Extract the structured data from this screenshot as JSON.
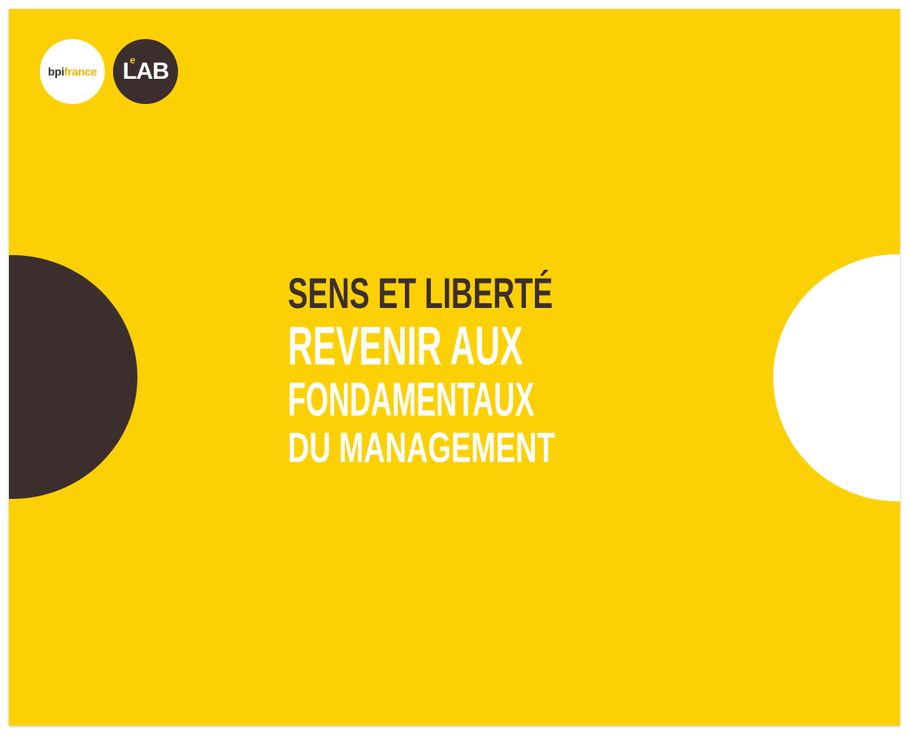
{
  "logos": {
    "bpi_part1": "bpi",
    "bpi_part2": "france",
    "lab_prefix": "L",
    "lab_sup": "e",
    "lab_suffix": "AB"
  },
  "title": {
    "line1": "SENS ET LIBERTÉ",
    "line2": "REVENIR AUX",
    "line3": "FONDAMENTAUX",
    "line4": "DU MANAGEMENT"
  },
  "colors": {
    "background": "#fbd106",
    "dark": "#3d2e2e",
    "light": "#ffffff"
  }
}
